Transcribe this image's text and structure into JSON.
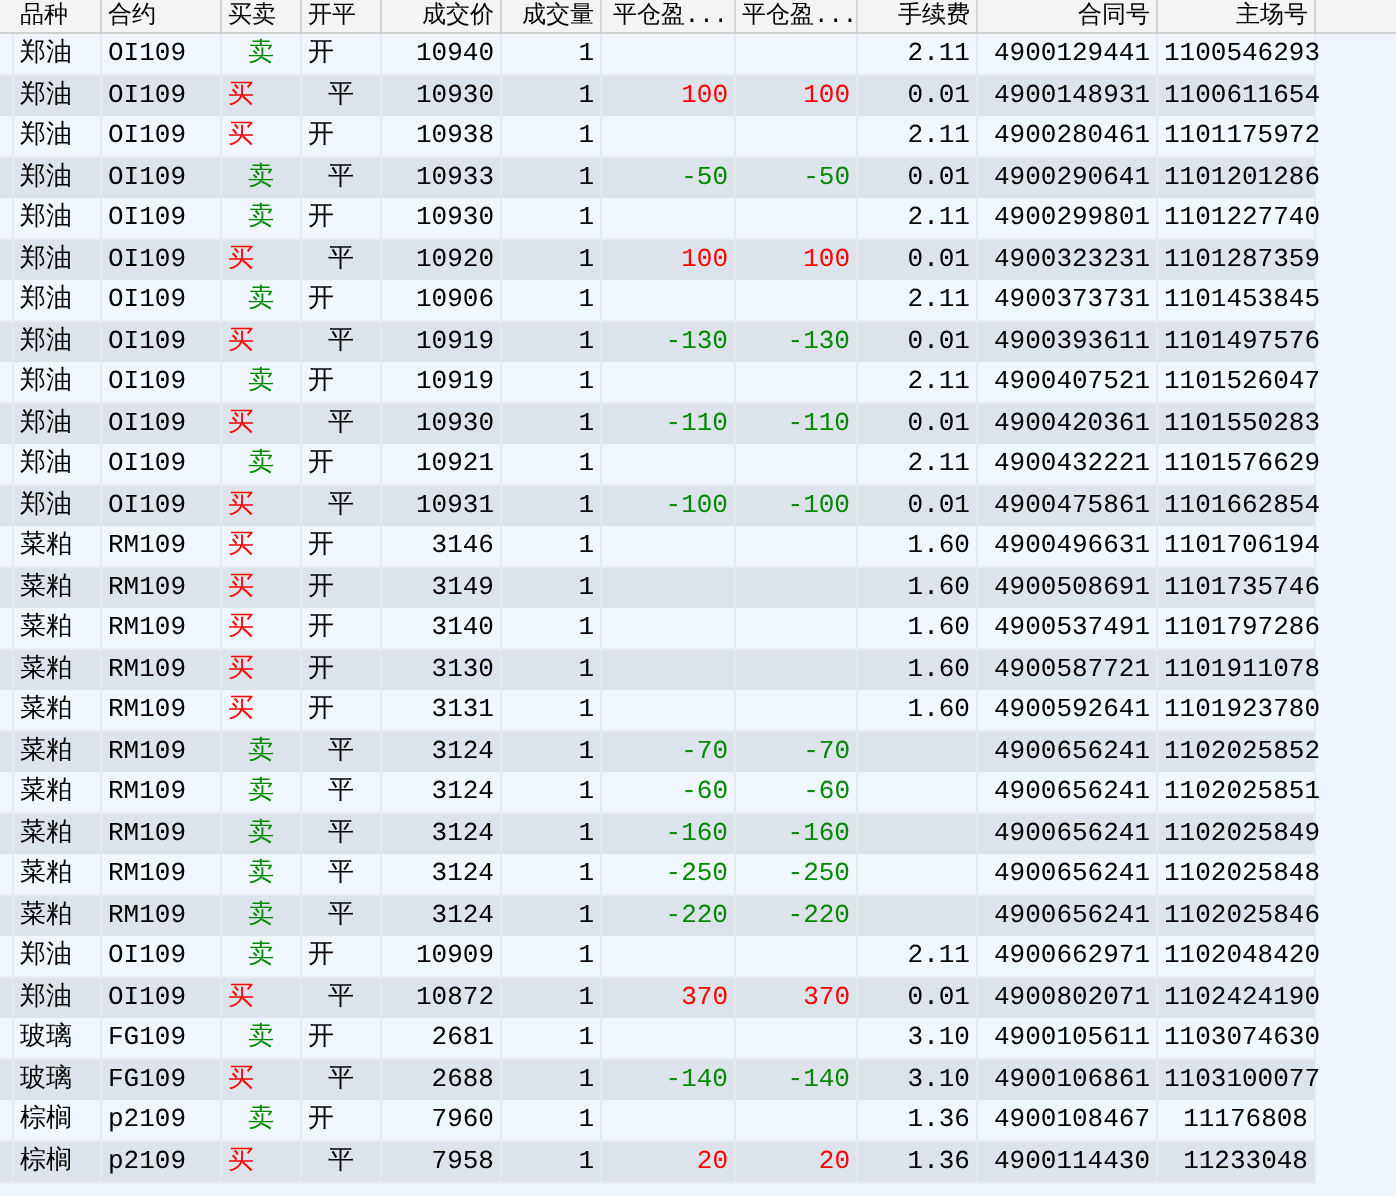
{
  "columns": [
    "品种",
    "合约",
    "买卖",
    "开平",
    "成交价",
    "成交量",
    "平仓盈...",
    "平仓盈...",
    "手续费",
    "合同号",
    "主场号"
  ],
  "rows": [
    {
      "product": "郑油",
      "contract": "OI109",
      "side": {
        "text": "卖",
        "kind": "sell"
      },
      "offset": {
        "text": "开",
        "kind": "open"
      },
      "price": "10940",
      "qty": "1",
      "fee": "2.11",
      "order_no": "4900129441",
      "trade_no": "1100546293"
    },
    {
      "product": "郑油",
      "contract": "OI109",
      "side": {
        "text": "买",
        "kind": "buy"
      },
      "offset": {
        "text": "平",
        "kind": "close"
      },
      "price": "10930",
      "qty": "1",
      "pnl": [
        {
          "text": "100",
          "kind": "gain"
        },
        {
          "text": "100",
          "kind": "gain"
        }
      ],
      "fee": "0.01",
      "order_no": "4900148931",
      "trade_no": "1100611654"
    },
    {
      "product": "郑油",
      "contract": "OI109",
      "side": {
        "text": "买",
        "kind": "buy"
      },
      "offset": {
        "text": "开",
        "kind": "open"
      },
      "price": "10938",
      "qty": "1",
      "fee": "2.11",
      "order_no": "4900280461",
      "trade_no": "1101175972"
    },
    {
      "product": "郑油",
      "contract": "OI109",
      "side": {
        "text": "卖",
        "kind": "sell"
      },
      "offset": {
        "text": "平",
        "kind": "close"
      },
      "price": "10933",
      "qty": "1",
      "pnl": [
        {
          "text": "-50",
          "kind": "loss"
        },
        {
          "text": "-50",
          "kind": "loss"
        }
      ],
      "fee": "0.01",
      "order_no": "4900290641",
      "trade_no": "1101201286"
    },
    {
      "product": "郑油",
      "contract": "OI109",
      "side": {
        "text": "卖",
        "kind": "sell"
      },
      "offset": {
        "text": "开",
        "kind": "open"
      },
      "price": "10930",
      "qty": "1",
      "fee": "2.11",
      "order_no": "4900299801",
      "trade_no": "1101227740"
    },
    {
      "product": "郑油",
      "contract": "OI109",
      "side": {
        "text": "买",
        "kind": "buy"
      },
      "offset": {
        "text": "平",
        "kind": "close"
      },
      "price": "10920",
      "qty": "1",
      "pnl": [
        {
          "text": "100",
          "kind": "gain"
        },
        {
          "text": "100",
          "kind": "gain"
        }
      ],
      "fee": "0.01",
      "order_no": "4900323231",
      "trade_no": "1101287359"
    },
    {
      "product": "郑油",
      "contract": "OI109",
      "side": {
        "text": "卖",
        "kind": "sell"
      },
      "offset": {
        "text": "开",
        "kind": "open"
      },
      "price": "10906",
      "qty": "1",
      "fee": "2.11",
      "order_no": "4900373731",
      "trade_no": "1101453845"
    },
    {
      "product": "郑油",
      "contract": "OI109",
      "side": {
        "text": "买",
        "kind": "buy"
      },
      "offset": {
        "text": "平",
        "kind": "close"
      },
      "price": "10919",
      "qty": "1",
      "pnl": [
        {
          "text": "-130",
          "kind": "loss"
        },
        {
          "text": "-130",
          "kind": "loss"
        }
      ],
      "fee": "0.01",
      "order_no": "4900393611",
      "trade_no": "1101497576"
    },
    {
      "product": "郑油",
      "contract": "OI109",
      "side": {
        "text": "卖",
        "kind": "sell"
      },
      "offset": {
        "text": "开",
        "kind": "open"
      },
      "price": "10919",
      "qty": "1",
      "fee": "2.11",
      "order_no": "4900407521",
      "trade_no": "1101526047"
    },
    {
      "product": "郑油",
      "contract": "OI109",
      "side": {
        "text": "买",
        "kind": "buy"
      },
      "offset": {
        "text": "平",
        "kind": "close"
      },
      "price": "10930",
      "qty": "1",
      "pnl": [
        {
          "text": "-110",
          "kind": "loss"
        },
        {
          "text": "-110",
          "kind": "loss"
        }
      ],
      "fee": "0.01",
      "order_no": "4900420361",
      "trade_no": "1101550283"
    },
    {
      "product": "郑油",
      "contract": "OI109",
      "side": {
        "text": "卖",
        "kind": "sell"
      },
      "offset": {
        "text": "开",
        "kind": "open"
      },
      "price": "10921",
      "qty": "1",
      "fee": "2.11",
      "order_no": "4900432221",
      "trade_no": "1101576629"
    },
    {
      "product": "郑油",
      "contract": "OI109",
      "side": {
        "text": "买",
        "kind": "buy"
      },
      "offset": {
        "text": "平",
        "kind": "close"
      },
      "price": "10931",
      "qty": "1",
      "pnl": [
        {
          "text": "-100",
          "kind": "loss"
        },
        {
          "text": "-100",
          "kind": "loss"
        }
      ],
      "fee": "0.01",
      "order_no": "4900475861",
      "trade_no": "1101662854"
    },
    {
      "product": "菜粕",
      "contract": "RM109",
      "side": {
        "text": "买",
        "kind": "buy"
      },
      "offset": {
        "text": "开",
        "kind": "open"
      },
      "price": "3146",
      "qty": "1",
      "fee": "1.60",
      "order_no": "4900496631",
      "trade_no": "1101706194"
    },
    {
      "product": "菜粕",
      "contract": "RM109",
      "side": {
        "text": "买",
        "kind": "buy"
      },
      "offset": {
        "text": "开",
        "kind": "open"
      },
      "price": "3149",
      "qty": "1",
      "fee": "1.60",
      "order_no": "4900508691",
      "trade_no": "1101735746"
    },
    {
      "product": "菜粕",
      "contract": "RM109",
      "side": {
        "text": "买",
        "kind": "buy"
      },
      "offset": {
        "text": "开",
        "kind": "open"
      },
      "price": "3140",
      "qty": "1",
      "fee": "1.60",
      "order_no": "4900537491",
      "trade_no": "1101797286"
    },
    {
      "product": "菜粕",
      "contract": "RM109",
      "side": {
        "text": "买",
        "kind": "buy"
      },
      "offset": {
        "text": "开",
        "kind": "open"
      },
      "price": "3130",
      "qty": "1",
      "fee": "1.60",
      "order_no": "4900587721",
      "trade_no": "1101911078"
    },
    {
      "product": "菜粕",
      "contract": "RM109",
      "side": {
        "text": "买",
        "kind": "buy"
      },
      "offset": {
        "text": "开",
        "kind": "open"
      },
      "price": "3131",
      "qty": "1",
      "fee": "1.60",
      "order_no": "4900592641",
      "trade_no": "1101923780"
    },
    {
      "product": "菜粕",
      "contract": "RM109",
      "side": {
        "text": "卖",
        "kind": "sell"
      },
      "offset": {
        "text": "平",
        "kind": "close"
      },
      "price": "3124",
      "qty": "1",
      "pnl": [
        {
          "text": "-70",
          "kind": "loss"
        },
        {
          "text": "-70",
          "kind": "loss"
        }
      ],
      "order_no": "4900656241",
      "trade_no": "1102025852"
    },
    {
      "product": "菜粕",
      "contract": "RM109",
      "side": {
        "text": "卖",
        "kind": "sell"
      },
      "offset": {
        "text": "平",
        "kind": "close"
      },
      "price": "3124",
      "qty": "1",
      "pnl": [
        {
          "text": "-60",
          "kind": "loss"
        },
        {
          "text": "-60",
          "kind": "loss"
        }
      ],
      "order_no": "4900656241",
      "trade_no": "1102025851"
    },
    {
      "product": "菜粕",
      "contract": "RM109",
      "side": {
        "text": "卖",
        "kind": "sell"
      },
      "offset": {
        "text": "平",
        "kind": "close"
      },
      "price": "3124",
      "qty": "1",
      "pnl": [
        {
          "text": "-160",
          "kind": "loss"
        },
        {
          "text": "-160",
          "kind": "loss"
        }
      ],
      "order_no": "4900656241",
      "trade_no": "1102025849"
    },
    {
      "product": "菜粕",
      "contract": "RM109",
      "side": {
        "text": "卖",
        "kind": "sell"
      },
      "offset": {
        "text": "平",
        "kind": "close"
      },
      "price": "3124",
      "qty": "1",
      "pnl": [
        {
          "text": "-250",
          "kind": "loss"
        },
        {
          "text": "-250",
          "kind": "loss"
        }
      ],
      "order_no": "4900656241",
      "trade_no": "1102025848"
    },
    {
      "product": "菜粕",
      "contract": "RM109",
      "side": {
        "text": "卖",
        "kind": "sell"
      },
      "offset": {
        "text": "平",
        "kind": "close"
      },
      "price": "3124",
      "qty": "1",
      "pnl": [
        {
          "text": "-220",
          "kind": "loss"
        },
        {
          "text": "-220",
          "kind": "loss"
        }
      ],
      "order_no": "4900656241",
      "trade_no": "1102025846"
    },
    {
      "product": "郑油",
      "contract": "OI109",
      "side": {
        "text": "卖",
        "kind": "sell"
      },
      "offset": {
        "text": "开",
        "kind": "open"
      },
      "price": "10909",
      "qty": "1",
      "fee": "2.11",
      "order_no": "4900662971",
      "trade_no": "1102048420"
    },
    {
      "product": "郑油",
      "contract": "OI109",
      "side": {
        "text": "买",
        "kind": "buy"
      },
      "offset": {
        "text": "平",
        "kind": "close"
      },
      "price": "10872",
      "qty": "1",
      "pnl": [
        {
          "text": "370",
          "kind": "gain"
        },
        {
          "text": "370",
          "kind": "gain"
        }
      ],
      "fee": "0.01",
      "order_no": "4900802071",
      "trade_no": "1102424190"
    },
    {
      "product": "玻璃",
      "contract": "FG109",
      "side": {
        "text": "卖",
        "kind": "sell"
      },
      "offset": {
        "text": "开",
        "kind": "open"
      },
      "price": "2681",
      "qty": "1",
      "fee": "3.10",
      "order_no": "4900105611",
      "trade_no": "1103074630"
    },
    {
      "product": "玻璃",
      "contract": "FG109",
      "side": {
        "text": "买",
        "kind": "buy"
      },
      "offset": {
        "text": "平",
        "kind": "close"
      },
      "price": "2688",
      "qty": "1",
      "pnl": [
        {
          "text": "-140",
          "kind": "loss"
        },
        {
          "text": "-140",
          "kind": "loss"
        }
      ],
      "fee": "3.10",
      "order_no": "4900106861",
      "trade_no": "1103100077"
    },
    {
      "product": "棕榈",
      "contract": "p2109",
      "side": {
        "text": "卖",
        "kind": "sell"
      },
      "offset": {
        "text": "开",
        "kind": "open"
      },
      "price": "7960",
      "qty": "1",
      "fee": "1.36",
      "order_no": "4900108467",
      "trade_no": "11176808"
    },
    {
      "product": "棕榈",
      "contract": "p2109",
      "side": {
        "text": "买",
        "kind": "buy"
      },
      "offset": {
        "text": "平",
        "kind": "close"
      },
      "price": "7958",
      "qty": "1",
      "pnl": [
        {
          "text": "20",
          "kind": "gain"
        },
        {
          "text": "20",
          "kind": "gain"
        }
      ],
      "fee": "1.36",
      "order_no": "4900114430",
      "trade_no": "11233048"
    }
  ]
}
